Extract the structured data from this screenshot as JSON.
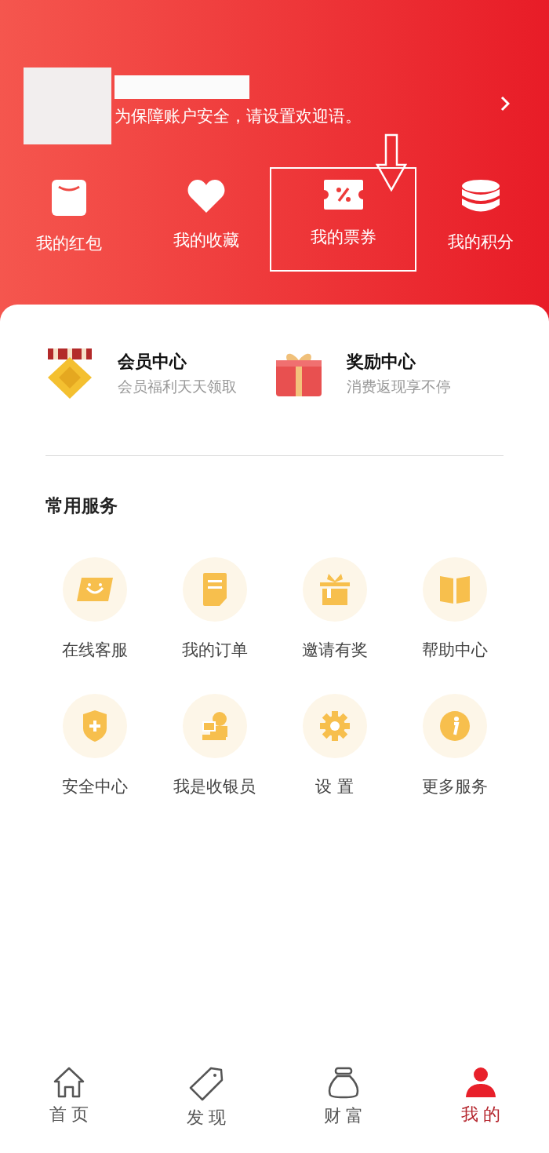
{
  "profile": {
    "greeting": "为保障账户安全，请设置欢迎语。"
  },
  "quick_links": [
    {
      "label": "我的红包",
      "highlighted": false
    },
    {
      "label": "我的收藏",
      "highlighted": false
    },
    {
      "label": "我的票券",
      "highlighted": true
    },
    {
      "label": "我的积分",
      "highlighted": false
    }
  ],
  "promos": [
    {
      "title": "会员中心",
      "subtitle": "会员福利天天领取"
    },
    {
      "title": "奖励中心",
      "subtitle": "消费返现享不停"
    }
  ],
  "services": {
    "title": "常用服务",
    "items": [
      {
        "label": "在线客服"
      },
      {
        "label": "我的订单"
      },
      {
        "label": "邀请有奖"
      },
      {
        "label": "帮助中心"
      },
      {
        "label": "安全中心"
      },
      {
        "label": "我是收银员"
      },
      {
        "label": "设 置"
      },
      {
        "label": "更多服务"
      }
    ]
  },
  "tabs": [
    {
      "label": "首页",
      "selected": false
    },
    {
      "label": "发现",
      "selected": false
    },
    {
      "label": "财富",
      "selected": false
    },
    {
      "label": "我的",
      "selected": true
    }
  ]
}
